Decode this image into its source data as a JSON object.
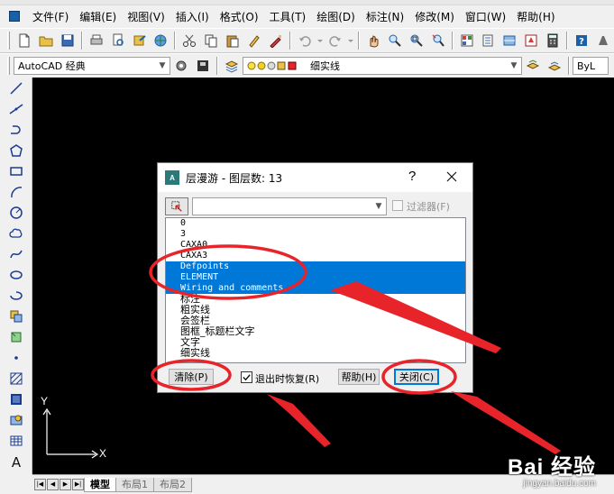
{
  "menu": [
    "文件(F)",
    "编辑(E)",
    "视图(V)",
    "插入(I)",
    "格式(O)",
    "工具(T)",
    "绘图(D)",
    "标注(N)",
    "修改(M)",
    "窗口(W)",
    "帮助(H)"
  ],
  "toolbar2": {
    "workspace": "AutoCAD 经典",
    "layer_current": "细实线",
    "bylayer": "ByL"
  },
  "dialog": {
    "title": "层漫游 - 图层数: 13",
    "help_glyph": "?",
    "filter_label": "过滤器(F)",
    "layers": [
      {
        "name": "0",
        "selected": false
      },
      {
        "name": "3",
        "selected": false
      },
      {
        "name": "CAXA0",
        "selected": false
      },
      {
        "name": "CAXA3",
        "selected": false
      },
      {
        "name": "Defpoints",
        "selected": true
      },
      {
        "name": "ELEMENT",
        "selected": true
      },
      {
        "name": "Wiring and comments",
        "selected": true
      },
      {
        "name": "标注",
        "selected": false
      },
      {
        "name": "粗实线",
        "selected": false
      },
      {
        "name": "会签栏",
        "selected": false
      },
      {
        "name": "图框_标题栏文字",
        "selected": false
      },
      {
        "name": "文字",
        "selected": false
      },
      {
        "name": "细实线",
        "selected": false
      }
    ],
    "clear_button": "清除(P)",
    "restore_on_exit_label": "退出时恢复(R)",
    "restore_on_exit_checked": true,
    "help_button": "帮助(H)",
    "close_button": "关闭(C)"
  },
  "ucs": {
    "x_label": "X",
    "y_label": "Y"
  },
  "tabs": [
    "模型",
    "布局1",
    "布局2"
  ],
  "watermark": {
    "logo": "Bai 经验",
    "url": "jingyan.baidu.com"
  },
  "colors": {
    "selection": "#0078d7",
    "annotation": "#e8242b",
    "canvas": "#000000"
  }
}
